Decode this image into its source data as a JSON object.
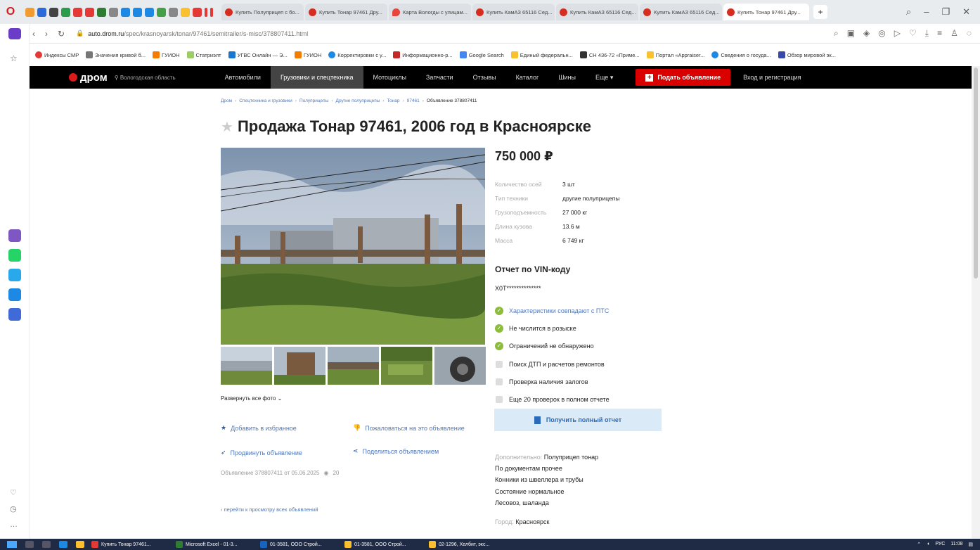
{
  "browser": {
    "tabs": [
      {
        "label": "Купить Полуприцеп с бо..."
      },
      {
        "label": "Купить Тонар 97461 Дру..."
      },
      {
        "label": "Карта Вологды с улицам..."
      },
      {
        "label": "Купить КамАЗ 65116 Сед..."
      },
      {
        "label": "Купить КамАЗ 65116 Сед..."
      },
      {
        "label": "Купить КамАЗ 65116 Сед..."
      },
      {
        "label": "Купить Тонар 97461 Дру..."
      }
    ],
    "url_domain": "auto.drom.ru",
    "url_path": "/spec/krasnoyarsk/tonar/97461/semitrailer/s-misc/378807411.html",
    "bookmarks": [
      "Индексы СМР",
      "Значения кривой б...",
      "ГУИОН",
      "Статриэлт",
      "УГВС Онлайн — Э...",
      "ГУИОН",
      "Корректировки с у...",
      "Информационно-р...",
      "Google Search",
      "Единый федеральн...",
      "СН 436-72 «Приме...",
      "Портал «Appraiser...",
      "Сведения о госуда...",
      "Обзор мировой эк..."
    ]
  },
  "header": {
    "logo": "дром",
    "region": "Вологодская область",
    "nav": [
      "Автомобили",
      "Грузовики и спецтехника",
      "Мотоциклы",
      "Запчасти",
      "Отзывы",
      "Каталог",
      "Шины",
      "Еще ▾"
    ],
    "post_ad": "Подать объявление",
    "login": "Вход и регистрация"
  },
  "breadcrumb": [
    "Дром",
    "Спецтехника и грузовики",
    "Полуприцепы",
    "Другие полуприцепы",
    "Тонар",
    "97461",
    "Объявление 378807411"
  ],
  "title": "Продажа Тонар 97461, 2006 год в Красноярске",
  "price": "750 000 ₽",
  "specs": [
    {
      "k": "Количество осей",
      "v": "3 шт"
    },
    {
      "k": "Тип техники",
      "v": "другие полуприцепы"
    },
    {
      "k": "Грузоподъемность",
      "v": "27 000 кг"
    },
    {
      "k": "Длина кузова",
      "v": "13.6 м"
    },
    {
      "k": "Масса",
      "v": "6 749 кг"
    }
  ],
  "expand_photos": "Развернуть все фото ⌄",
  "actions": {
    "favorite": "Добавить в избранное",
    "complain": "Пожаловаться на это объявление",
    "promote": "Продвинуть объявление",
    "share": "Поделиться объявлением"
  },
  "ad_meta": {
    "text": "Объявление 378807411 от 05.06.2025",
    "views": "20"
  },
  "back_link": "‹ перейти к просмотру всех объявлений",
  "vin": {
    "title": "Отчет по VIN-коду",
    "code": "X0T**************",
    "checks": [
      {
        "text": "Характеристики совпадают с ПТС",
        "status": "ok",
        "link": true
      },
      {
        "text": "Не числится в розыске",
        "status": "ok",
        "link": false
      },
      {
        "text": "Ограничений не обнаружено",
        "status": "ok",
        "link": false
      },
      {
        "text": "Поиск ДТП и расчетов ремонтов",
        "status": "locked",
        "link": false
      },
      {
        "text": "Проверка наличия залогов",
        "status": "locked",
        "link": false
      },
      {
        "text": "Еще 20 проверок в полном отчете",
        "status": "locked",
        "link": false
      }
    ],
    "button": "Получить полный отчет"
  },
  "extra": {
    "label": "Дополнительно:",
    "lines": [
      "Полуприцеп тонар",
      "По документам прочее",
      "Конники из швеллера и трубы",
      "Состояние нормальное",
      "Лесовоз, шаланда"
    ]
  },
  "city": {
    "label": "Город:",
    "value": "Красноярск"
  },
  "taskbar": {
    "apps": [
      "Купить Тонар 97461...",
      "Microsoft Excel - 01-3...",
      "01-3581, ООО Строй...",
      "01-3581, ООО Строй...",
      "02-1296, Хелбит, экс..."
    ],
    "lang": "РУС",
    "time": "11:08"
  }
}
